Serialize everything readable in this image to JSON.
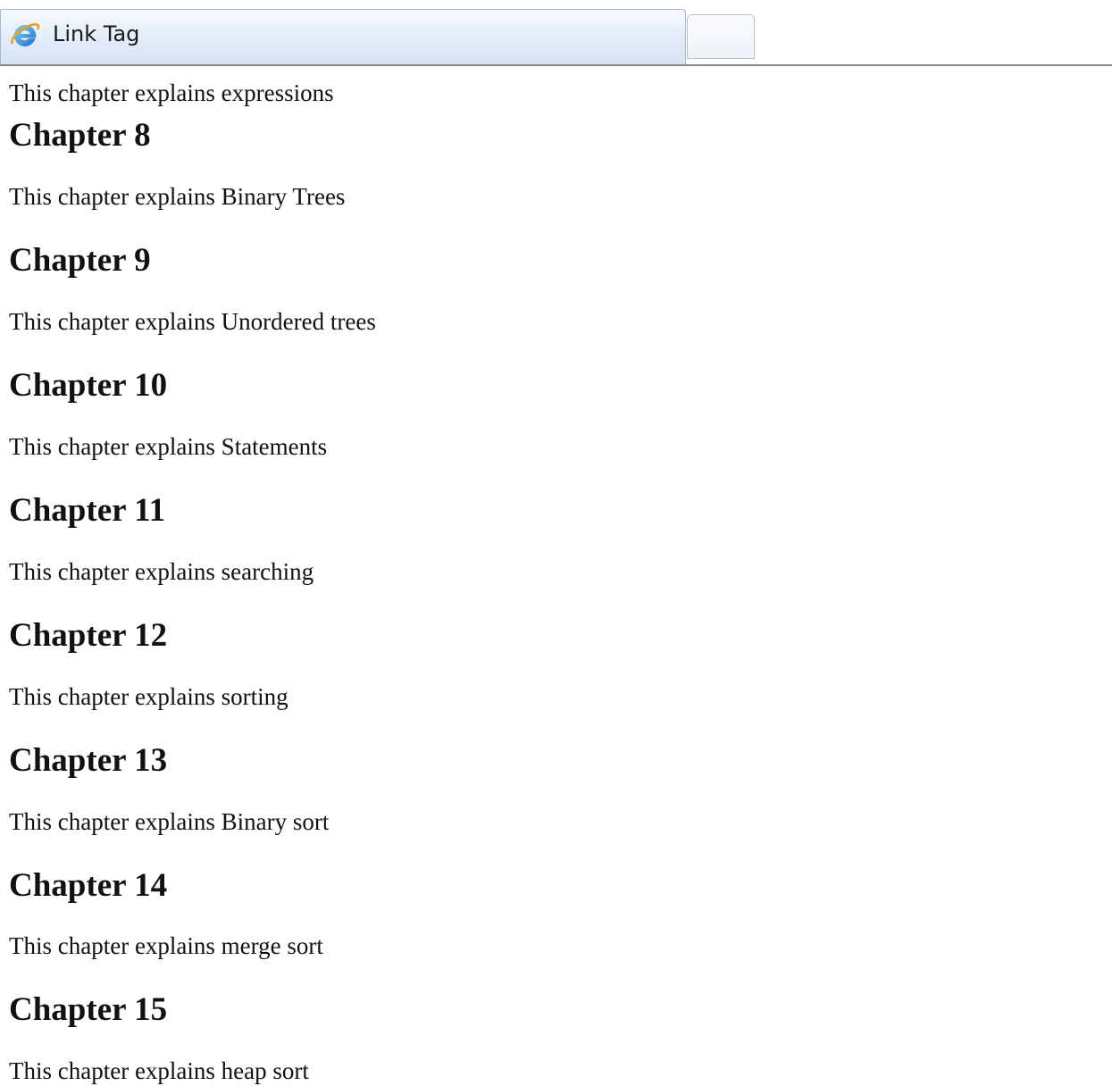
{
  "tab": {
    "title": "Link Tag",
    "icon": "internet-explorer-icon"
  },
  "page": {
    "cut_off_text": "This chapter explains expressions",
    "chapters": [
      {
        "heading": "Chapter 8",
        "text": "This chapter explains Binary Trees"
      },
      {
        "heading": "Chapter 9",
        "text": "This chapter explains Unordered trees"
      },
      {
        "heading": "Chapter 10",
        "text": "This chapter explains Statements"
      },
      {
        "heading": "Chapter 11",
        "text": "This chapter explains searching"
      },
      {
        "heading": "Chapter 12",
        "text": "This chapter explains sorting"
      },
      {
        "heading": "Chapter 13",
        "text": "This chapter explains Binary sort"
      },
      {
        "heading": "Chapter 14",
        "text": "This chapter explains merge sort"
      },
      {
        "heading": "Chapter 15",
        "text": "This chapter explains heap sort"
      }
    ]
  }
}
